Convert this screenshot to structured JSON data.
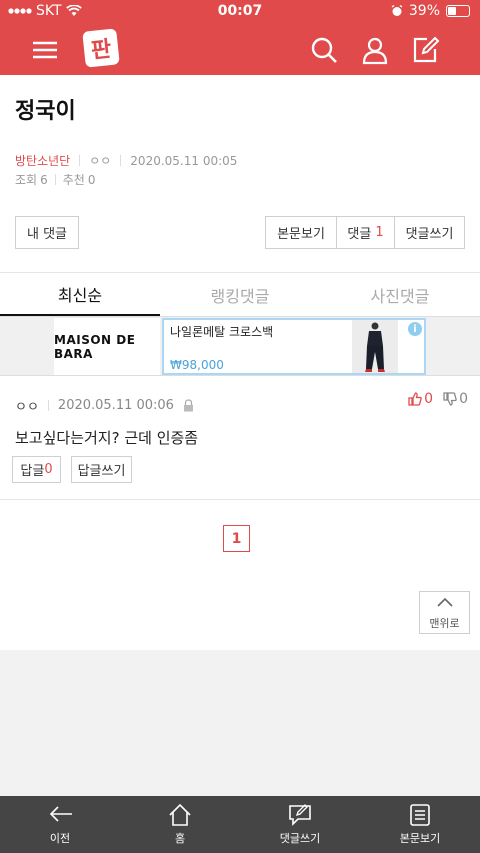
{
  "status": {
    "carrier": "SKT",
    "time": "00:07",
    "battery": "39%",
    "battery_level": 0.39
  },
  "nav": {
    "logo": "판"
  },
  "post": {
    "title": "정국이",
    "category": "방탄소년단",
    "author": "ㅇㅇ",
    "datetime": "2020.05.11 00:05",
    "views_label": "조회",
    "views": "6",
    "recommend_label": "추천",
    "recommend": "0"
  },
  "buttons": {
    "my_comments": "내 댓글",
    "view_post": "본문보기",
    "comments_label": "댓글",
    "comments_count": "1",
    "write_comment": "댓글쓰기"
  },
  "tabs": [
    {
      "label": "최신순",
      "active": true
    },
    {
      "label": "랭킹댓글",
      "active": false
    },
    {
      "label": "사진댓글",
      "active": false
    }
  ],
  "ad": {
    "brand": "MAISON DE BARA",
    "product": "나일론메탈 크로스백",
    "price": "₩98,000",
    "info": "i"
  },
  "comment": {
    "author": "ㅇㅇ",
    "datetime": "2020.05.11 00:06",
    "likes": "0",
    "dislikes": "0",
    "text": "보고싶다는거지? 근데 인증좀",
    "reply_label": "답글",
    "reply_count": "0",
    "write_reply": "답글쓰기"
  },
  "pagination": {
    "current": "1"
  },
  "to_top": "맨위로",
  "bottom_nav": [
    {
      "label": "이전",
      "icon": "back-arrow-icon"
    },
    {
      "label": "홈",
      "icon": "home-icon"
    },
    {
      "label": "댓글쓰기",
      "icon": "comment-write-icon"
    },
    {
      "label": "본문보기",
      "icon": "document-icon"
    }
  ],
  "colors": {
    "brand": "#e14a4a",
    "ad_border": "#a9d7f5",
    "price": "#4aa3d9",
    "bottom_bar": "#454545"
  }
}
